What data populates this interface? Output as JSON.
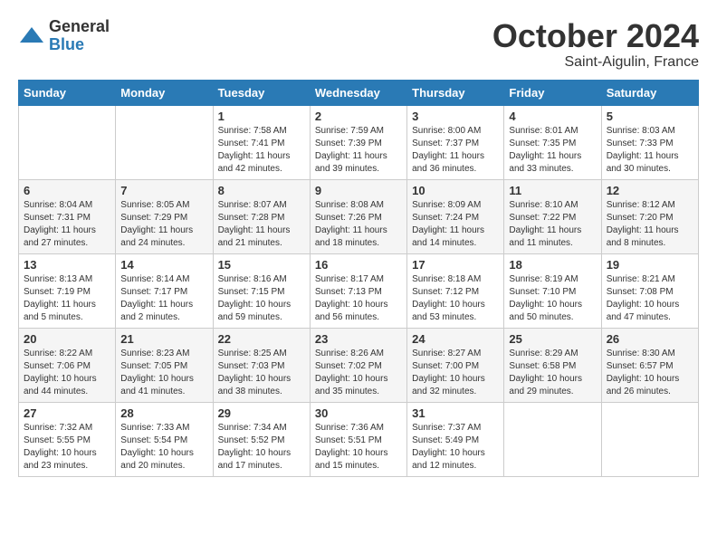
{
  "header": {
    "logo_general": "General",
    "logo_blue": "Blue",
    "month_title": "October 2024",
    "location": "Saint-Aigulin, France"
  },
  "weekdays": [
    "Sunday",
    "Monday",
    "Tuesday",
    "Wednesday",
    "Thursday",
    "Friday",
    "Saturday"
  ],
  "weeks": [
    [
      {
        "day": "",
        "info": ""
      },
      {
        "day": "",
        "info": ""
      },
      {
        "day": "1",
        "info": "Sunrise: 7:58 AM\nSunset: 7:41 PM\nDaylight: 11 hours and 42 minutes."
      },
      {
        "day": "2",
        "info": "Sunrise: 7:59 AM\nSunset: 7:39 PM\nDaylight: 11 hours and 39 minutes."
      },
      {
        "day": "3",
        "info": "Sunrise: 8:00 AM\nSunset: 7:37 PM\nDaylight: 11 hours and 36 minutes."
      },
      {
        "day": "4",
        "info": "Sunrise: 8:01 AM\nSunset: 7:35 PM\nDaylight: 11 hours and 33 minutes."
      },
      {
        "day": "5",
        "info": "Sunrise: 8:03 AM\nSunset: 7:33 PM\nDaylight: 11 hours and 30 minutes."
      }
    ],
    [
      {
        "day": "6",
        "info": "Sunrise: 8:04 AM\nSunset: 7:31 PM\nDaylight: 11 hours and 27 minutes."
      },
      {
        "day": "7",
        "info": "Sunrise: 8:05 AM\nSunset: 7:29 PM\nDaylight: 11 hours and 24 minutes."
      },
      {
        "day": "8",
        "info": "Sunrise: 8:07 AM\nSunset: 7:28 PM\nDaylight: 11 hours and 21 minutes."
      },
      {
        "day": "9",
        "info": "Sunrise: 8:08 AM\nSunset: 7:26 PM\nDaylight: 11 hours and 18 minutes."
      },
      {
        "day": "10",
        "info": "Sunrise: 8:09 AM\nSunset: 7:24 PM\nDaylight: 11 hours and 14 minutes."
      },
      {
        "day": "11",
        "info": "Sunrise: 8:10 AM\nSunset: 7:22 PM\nDaylight: 11 hours and 11 minutes."
      },
      {
        "day": "12",
        "info": "Sunrise: 8:12 AM\nSunset: 7:20 PM\nDaylight: 11 hours and 8 minutes."
      }
    ],
    [
      {
        "day": "13",
        "info": "Sunrise: 8:13 AM\nSunset: 7:19 PM\nDaylight: 11 hours and 5 minutes."
      },
      {
        "day": "14",
        "info": "Sunrise: 8:14 AM\nSunset: 7:17 PM\nDaylight: 11 hours and 2 minutes."
      },
      {
        "day": "15",
        "info": "Sunrise: 8:16 AM\nSunset: 7:15 PM\nDaylight: 10 hours and 59 minutes."
      },
      {
        "day": "16",
        "info": "Sunrise: 8:17 AM\nSunset: 7:13 PM\nDaylight: 10 hours and 56 minutes."
      },
      {
        "day": "17",
        "info": "Sunrise: 8:18 AM\nSunset: 7:12 PM\nDaylight: 10 hours and 53 minutes."
      },
      {
        "day": "18",
        "info": "Sunrise: 8:19 AM\nSunset: 7:10 PM\nDaylight: 10 hours and 50 minutes."
      },
      {
        "day": "19",
        "info": "Sunrise: 8:21 AM\nSunset: 7:08 PM\nDaylight: 10 hours and 47 minutes."
      }
    ],
    [
      {
        "day": "20",
        "info": "Sunrise: 8:22 AM\nSunset: 7:06 PM\nDaylight: 10 hours and 44 minutes."
      },
      {
        "day": "21",
        "info": "Sunrise: 8:23 AM\nSunset: 7:05 PM\nDaylight: 10 hours and 41 minutes."
      },
      {
        "day": "22",
        "info": "Sunrise: 8:25 AM\nSunset: 7:03 PM\nDaylight: 10 hours and 38 minutes."
      },
      {
        "day": "23",
        "info": "Sunrise: 8:26 AM\nSunset: 7:02 PM\nDaylight: 10 hours and 35 minutes."
      },
      {
        "day": "24",
        "info": "Sunrise: 8:27 AM\nSunset: 7:00 PM\nDaylight: 10 hours and 32 minutes."
      },
      {
        "day": "25",
        "info": "Sunrise: 8:29 AM\nSunset: 6:58 PM\nDaylight: 10 hours and 29 minutes."
      },
      {
        "day": "26",
        "info": "Sunrise: 8:30 AM\nSunset: 6:57 PM\nDaylight: 10 hours and 26 minutes."
      }
    ],
    [
      {
        "day": "27",
        "info": "Sunrise: 7:32 AM\nSunset: 5:55 PM\nDaylight: 10 hours and 23 minutes."
      },
      {
        "day": "28",
        "info": "Sunrise: 7:33 AM\nSunset: 5:54 PM\nDaylight: 10 hours and 20 minutes."
      },
      {
        "day": "29",
        "info": "Sunrise: 7:34 AM\nSunset: 5:52 PM\nDaylight: 10 hours and 17 minutes."
      },
      {
        "day": "30",
        "info": "Sunrise: 7:36 AM\nSunset: 5:51 PM\nDaylight: 10 hours and 15 minutes."
      },
      {
        "day": "31",
        "info": "Sunrise: 7:37 AM\nSunset: 5:49 PM\nDaylight: 10 hours and 12 minutes."
      },
      {
        "day": "",
        "info": ""
      },
      {
        "day": "",
        "info": ""
      }
    ]
  ]
}
